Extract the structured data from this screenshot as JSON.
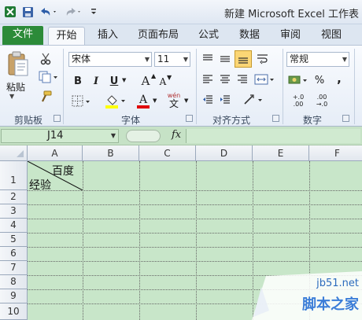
{
  "title": "新建 Microsoft Excel 工作表",
  "quick_access": [
    "excel-logo-icon",
    "save-icon",
    "undo-icon",
    "redo-icon",
    "customize-icon"
  ],
  "tabs": [
    {
      "label": "文件"
    },
    {
      "label": "开始"
    },
    {
      "label": "插入"
    },
    {
      "label": "页面布局"
    },
    {
      "label": "公式"
    },
    {
      "label": "数据"
    },
    {
      "label": "审阅"
    },
    {
      "label": "视图"
    }
  ],
  "ribbon": {
    "clipboard": {
      "paste_label": "粘贴",
      "group_label": "剪贴板"
    },
    "font": {
      "font_name": "宋体",
      "font_size": "11",
      "bold": "B",
      "italic": "I",
      "underline": "U",
      "grow": "A",
      "shrink": "A",
      "font_color_letter": "A",
      "wen": "wén",
      "wen_char": "文",
      "group_label": "字体",
      "accent_fill": "#ffff00",
      "accent_font": "#e00000"
    },
    "alignment": {
      "group_label": "对齐方式"
    },
    "number": {
      "format": "常规",
      "percent": "%",
      "comma": ",",
      "dec_inc": "+.0",
      "dec_inc2": ".00",
      "dec_dec": ".00",
      "dec_dec2": "→.0",
      "group_label": "数字"
    }
  },
  "formula_bar": {
    "name_box": "J14",
    "fx": "fx",
    "value": ""
  },
  "columns": [
    "A",
    "B",
    "C",
    "D",
    "E",
    "F"
  ],
  "rows": [
    "1",
    "2",
    "3",
    "4",
    "5",
    "6",
    "7",
    "8",
    "9",
    "10"
  ],
  "cell_a1": {
    "top_right": "百度",
    "bottom_left": "经验"
  },
  "watermark": {
    "site": "jb51.net",
    "name": "脚本之家"
  }
}
